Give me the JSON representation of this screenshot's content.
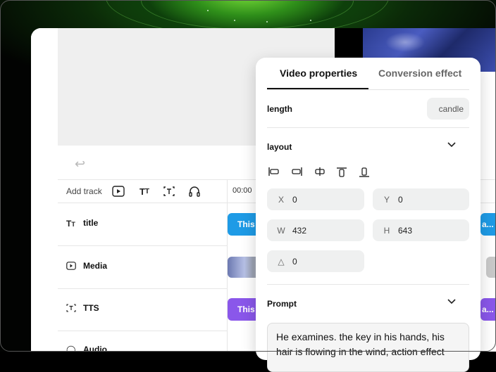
{
  "panel": {
    "tabs": [
      {
        "label": "Video properties",
        "active": true
      },
      {
        "label": "Conversion effect",
        "active": false
      }
    ],
    "length_label": "length",
    "length_value": "candle",
    "layout_label": "layout",
    "fields": {
      "x": {
        "key": "X",
        "value": "0"
      },
      "y": {
        "key": "Y",
        "value": "0"
      },
      "w": {
        "key": "W",
        "value": "432"
      },
      "h": {
        "key": "H",
        "value": "643"
      },
      "rotation": {
        "key": "△",
        "value": "0"
      }
    },
    "prompt_label": "Prompt",
    "prompt_text": "He examines. the key in his hands, his hair is flowing in the wind, action effect"
  },
  "timeline": {
    "add_track_label": "Add track",
    "timecode": "00:00",
    "tracks": [
      {
        "label": "title",
        "icon": "text-track-icon"
      },
      {
        "label": "Media",
        "icon": "play-icon"
      },
      {
        "label": "TTS",
        "icon": "tts-icon"
      },
      {
        "label": "Audio",
        "icon": "audio-icon"
      }
    ],
    "clips": {
      "title_clip": "This",
      "tts_clip": "This",
      "right_title_clip": "a...",
      "right_tts_clip": "a..."
    }
  },
  "colors": {
    "title_clip": "#1e9be6",
    "tts_clip": "#8a57ea",
    "accent": "#111111"
  }
}
